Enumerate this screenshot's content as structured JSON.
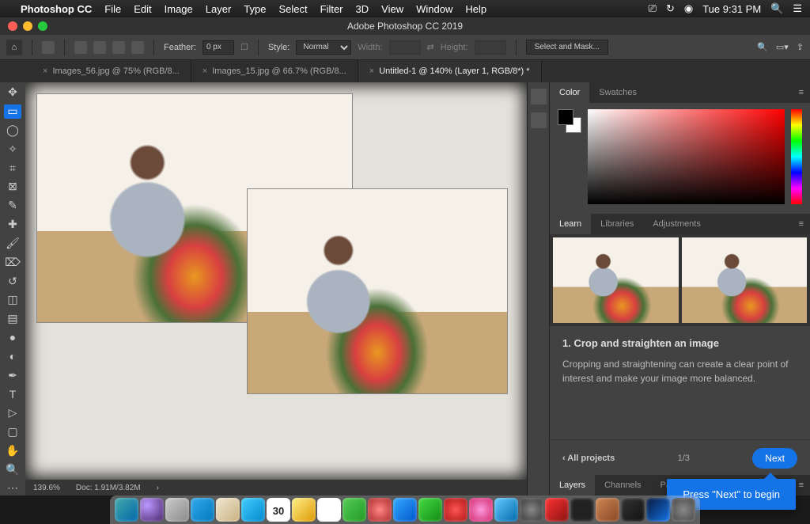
{
  "mac_menu": {
    "app_name": "Photoshop CC",
    "items": [
      "File",
      "Edit",
      "Image",
      "Layer",
      "Type",
      "Select",
      "Filter",
      "3D",
      "View",
      "Window",
      "Help"
    ],
    "clock": "Tue 9:31 PM"
  },
  "window_title": "Adobe Photoshop CC 2019",
  "options_bar": {
    "feather_label": "Feather:",
    "feather_value": "0 px",
    "style_label": "Style:",
    "style_value": "Normal",
    "width_label": "Width:",
    "height_label": "Height:",
    "select_mask_label": "Select and Mask..."
  },
  "doc_tabs": [
    {
      "label": "Images_56.jpg @ 75% (RGB/8...",
      "active": false
    },
    {
      "label": "Images_15.jpg @ 66.7% (RGB/8...",
      "active": false
    },
    {
      "label": "Untitled-1 @ 140% (Layer 1, RGB/8*) *",
      "active": true
    }
  ],
  "status": {
    "zoom": "139.6%",
    "doc": "Doc: 1.91M/3.82M"
  },
  "color_panel": {
    "tabs": [
      "Color",
      "Swatches"
    ],
    "active": "Color"
  },
  "learn_panel": {
    "tabs": [
      "Learn",
      "Libraries",
      "Adjustments"
    ],
    "active": "Learn",
    "step_title": "1.  Crop and straighten an image",
    "step_body": "Cropping and straightening can create a clear point of interest and make your image more balanced.",
    "back_label": "‹ All projects",
    "progress": "1/3",
    "next_label": "Next"
  },
  "layers_panel": {
    "tabs": [
      "Layers",
      "Channels",
      "Paths"
    ],
    "active": "Layers"
  },
  "tooltip_text": "Press \"Next\" to begin",
  "tools": [
    "move",
    "marquee",
    "lasso",
    "wand",
    "crop",
    "frame",
    "eyedropper",
    "heal",
    "brush",
    "stamp",
    "history",
    "eraser",
    "gradient",
    "blur",
    "dodge",
    "pen",
    "type",
    "path",
    "rect",
    "hand",
    "zoom"
  ]
}
